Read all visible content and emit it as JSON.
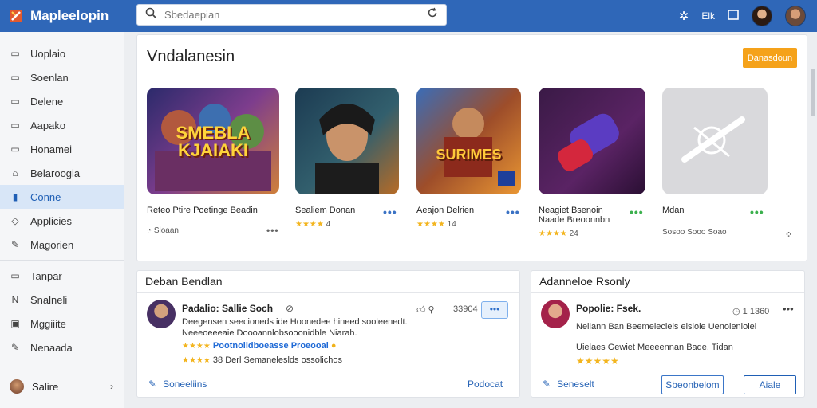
{
  "app": {
    "name": "Mapleelopin",
    "search_placeholder": "Sbedaepian",
    "top_text": "Elk"
  },
  "sidebar": {
    "items": [
      {
        "label": "Uoplaio",
        "icon": "square-icon"
      },
      {
        "label": "Soenlan",
        "icon": "square-icon"
      },
      {
        "label": "Delene",
        "icon": "square-icon"
      },
      {
        "label": "Aapako",
        "icon": "square-icon"
      },
      {
        "label": "Honamei",
        "icon": "square-icon"
      },
      {
        "label": "Belaroogia",
        "icon": "tag-icon"
      },
      {
        "label": "Conne",
        "icon": "shield-icon",
        "active": true
      },
      {
        "label": "Applicies",
        "icon": "diamond-icon"
      },
      {
        "label": "Magorien",
        "icon": "pencil-icon"
      }
    ],
    "items2": [
      {
        "label": "Tanpar",
        "icon": "clipboard-icon"
      },
      {
        "label": "Snalneli",
        "icon": "n-icon"
      },
      {
        "label": "Mggiiite",
        "icon": "image-icon"
      },
      {
        "label": "Nenaada",
        "icon": "pencil-icon"
      }
    ],
    "footer_label": "Salire"
  },
  "featured": {
    "title": "Vndalanesin",
    "action_label": "Danasdoun",
    "cards": [
      {
        "title": "Reteo Ptire Poetinge Beadin",
        "meta": "Sloaan",
        "rating": "★★★★",
        "rating_num": ""
      },
      {
        "title": "Sealiem Donan",
        "meta": "",
        "rating": "★★★★",
        "rating_num": "4"
      },
      {
        "title": "Aeajon Delrien",
        "meta": "",
        "rating": "★★★★",
        "rating_num": "14"
      },
      {
        "title": "Neagiet Bsenoin",
        "sub": "Naade Breoonnbn",
        "meta": "",
        "rating": "★★★★",
        "rating_num": "24"
      },
      {
        "title": "Mdan",
        "meta": "Sosoo Sooo Soao",
        "rating": "",
        "rating_num": ""
      }
    ],
    "thumb_texts": [
      "SMEBLA KJAIAKI",
      "",
      "SURIMES",
      "",
      ""
    ]
  },
  "reviews_left": {
    "title": "Deban Bendlan",
    "name": "Padalio: Sallie Soch",
    "lines": [
      "Deegensen seecioneds ide Hoonedee hineed sooleenedt.",
      "Neeeoeeeaie Doooannlobsooonidble Niarah."
    ],
    "tag": "Pootnolidboeasse Proeooal",
    "counts": "38 Derl   Semaneleslds ossolichos",
    "vote": "33904",
    "like_label": "Soneeliins",
    "post_label": "Podocat"
  },
  "reviews_right": {
    "title": "Adanneloe Rsonly",
    "name": "Popolie: Fsek.",
    "time": "1 1360",
    "lines": [
      "Neliann Ban Beemeleclels eisiole Uenolenloiel",
      "Uielaes Gewiet Meeeennan Bade. Tidan"
    ],
    "share_label": "Seneselt",
    "btn1": "Sbeonbelom",
    "btn2": "Aiale"
  },
  "colors": {
    "topbar": "#2f67b8",
    "accent": "#f5a21a",
    "link": "#2a66b7",
    "star": "#f3b51f"
  }
}
